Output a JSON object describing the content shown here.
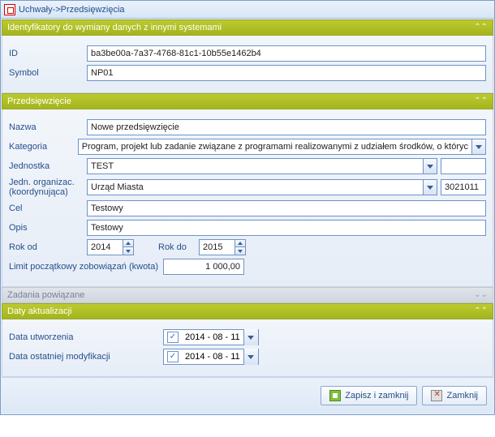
{
  "window": {
    "title": "Uchwały->Przedsięwzięcia"
  },
  "section_ids": {
    "title": "Identyfikatory do wymiany danych z innymi systemami",
    "id_label": "ID",
    "id_value": "ba3be00a-7a37-4768-81c1-10b55e1462b4",
    "symbol_label": "Symbol",
    "symbol_value": "NP01"
  },
  "section_prz": {
    "title": "Przedsięwzięcie",
    "nazwa_label": "Nazwa",
    "nazwa_value": "Nowe przedsięwzięcie",
    "kategoria_label": "Kategoria",
    "kategoria_value": "Program, projekt lub zadanie związane z programami realizowanymi z udziałem środków, o któryc",
    "jednostka_label": "Jednostka",
    "jednostka_value": "TEST",
    "jednostka_extra": "",
    "jedn_org_label_l1": "Jedn. organizac.",
    "jedn_org_label_l2": "(koordynująca)",
    "jedn_org_value": "Urząd Miasta",
    "jedn_org_code": "3021011",
    "cel_label": "Cel",
    "cel_value": "Testowy",
    "opis_label": "Opis",
    "opis_value": "Testowy",
    "rok_od_label": "Rok od",
    "rok_od_value": "2014",
    "rok_do_label": "Rok do",
    "rok_do_value": "2015",
    "limit_label": "Limit początkowy zobowiązań (kwota)",
    "limit_value": "1 000,00"
  },
  "section_zadania": {
    "title": "Zadania powiązane"
  },
  "section_daty": {
    "title": "Daty aktualizacji",
    "utworzenia_label": "Data utworzenia",
    "utworzenia_value": "2014  -  08  -  11",
    "modyfikacji_label": "Data ostatniej modyfikacji",
    "modyfikacji_value": "2014  -  08  -  11"
  },
  "buttons": {
    "save_close": "Zapisz i zamknij",
    "close": "Zamknij"
  }
}
